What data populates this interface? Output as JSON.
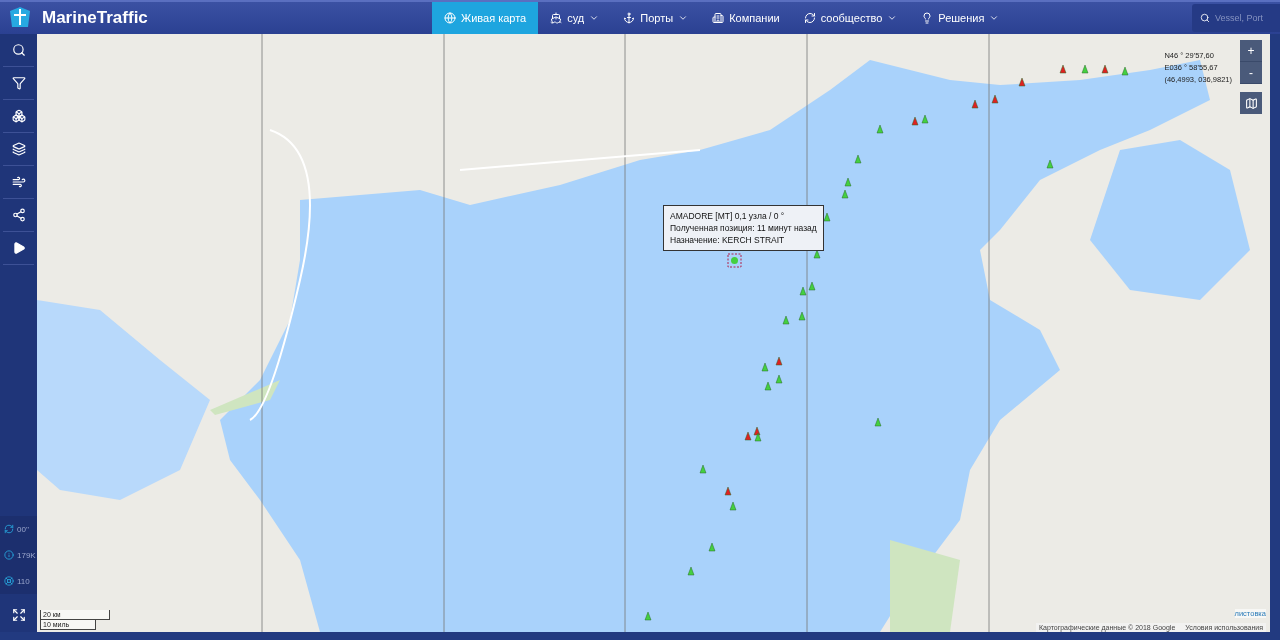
{
  "brand": {
    "name": "MarineTraffic"
  },
  "nav": [
    {
      "label": "Живая карта",
      "dropdown": false,
      "selected": true
    },
    {
      "label": "суд",
      "dropdown": true,
      "selected": false
    },
    {
      "label": "Порты",
      "dropdown": true,
      "selected": false
    },
    {
      "label": "Компании",
      "dropdown": false,
      "selected": false
    },
    {
      "label": "сообщество",
      "dropdown": true,
      "selected": false
    },
    {
      "label": "Решения",
      "dropdown": true,
      "selected": false
    }
  ],
  "search": {
    "placeholder": "Vessel, Port"
  },
  "sidebar": {
    "tools": [
      {
        "kind": "search"
      },
      {
        "kind": "filter"
      },
      {
        "kind": "cluster"
      },
      {
        "kind": "layers"
      },
      {
        "kind": "wind"
      },
      {
        "kind": "network"
      },
      {
        "kind": "play"
      }
    ],
    "stats": [
      {
        "kind": "refresh",
        "value": "00''"
      },
      {
        "kind": "info",
        "value": "179K"
      },
      {
        "kind": "wheel",
        "value": "110"
      }
    ]
  },
  "map": {
    "coordinates": [
      "N46 ° 29'57,60",
      "E036 ° 58'55,67",
      "(46,4993, 036,9821)"
    ],
    "zoom": [
      "+",
      "-"
    ],
    "tooltip": [
      "AMADORE [MT] 0,1 узла / 0 °",
      "Полученная позиция: 11 минут назад",
      "Назначение: KERCH STRAIT"
    ],
    "scale": [
      "20 км",
      "10 миль"
    ],
    "leaflet_label": "листовка",
    "attribution": [
      "Картографические данные © 2018 Google",
      "Условия использования"
    ]
  }
}
